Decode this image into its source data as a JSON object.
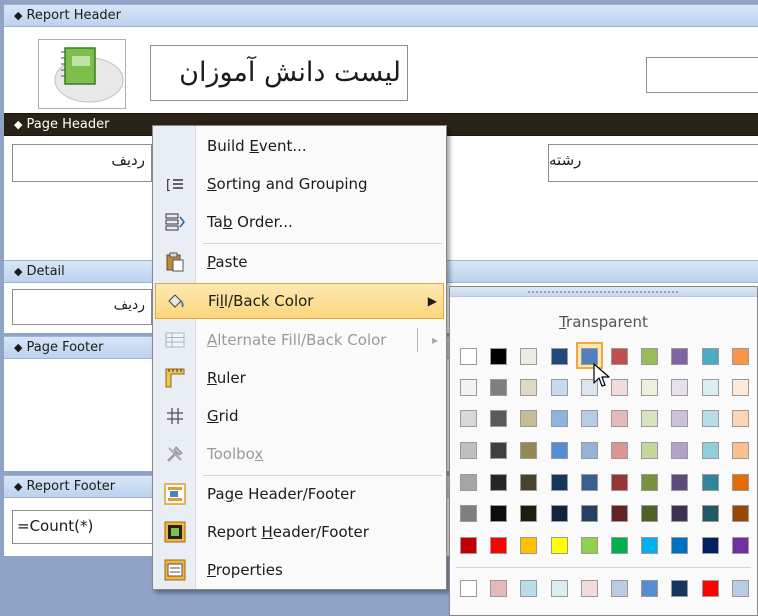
{
  "bands": {
    "report_header": "Report Header",
    "page_header": "Page Header",
    "detail": "Detail",
    "page_footer": "Page Footer",
    "report_footer": "Report Footer"
  },
  "controls": {
    "report_title": "لیست دانش آموزان",
    "header_label_row": "ردیف",
    "header_label_major": "رشته",
    "detail_row_field": "ردیف",
    "footer_count": "=Count(*)"
  },
  "menu": {
    "build_event": {
      "pre": "Build ",
      "key": "E",
      "post": "vent..."
    },
    "sorting": {
      "pre": "",
      "key": "S",
      "post": "orting and Grouping"
    },
    "tab_order": {
      "pre": "Ta",
      "key": "b",
      "post": " Order..."
    },
    "paste": {
      "pre": "",
      "key": "P",
      "post": "aste"
    },
    "fill_back": {
      "pre": "Fi",
      "key": "l",
      "post": "l/Back Color"
    },
    "alternate": {
      "pre": "",
      "key": "A",
      "post": "lternate Fill/Back Color"
    },
    "ruler": {
      "pre": "",
      "key": "R",
      "post": "uler"
    },
    "grid": {
      "pre": "",
      "key": "G",
      "post": "rid"
    },
    "toolbox": {
      "pre": "Toolbo",
      "key": "x",
      "post": ""
    },
    "page_hf": {
      "pre": "Pa",
      "key": "g",
      "post": "e Header/Footer"
    },
    "report_hf": {
      "pre": "Report ",
      "key": "H",
      "post": "eader/Footer"
    },
    "properties": {
      "pre": "",
      "key": "P",
      "post": "roperties"
    }
  },
  "palette": {
    "transparent": {
      "pre": "",
      "key": "T",
      "post": "ransparent"
    },
    "rows": [
      [
        "#ffffff",
        "#000000",
        "#eeece1",
        "#1f497d",
        "#4f81bd",
        "#c0504d",
        "#9bbb59",
        "#8064a2",
        "#4bacc6",
        "#f79646"
      ],
      [
        "#f2f2f2",
        "#7f7f7f",
        "#ddd9c3",
        "#c6d9f0",
        "#dbe5f1",
        "#f2dcdb",
        "#ebf1dd",
        "#e5e0ec",
        "#dbeef3",
        "#fdeada"
      ],
      [
        "#d8d8d8",
        "#595959",
        "#c4bd97",
        "#8db3e2",
        "#b8cce4",
        "#e5b9b7",
        "#d7e3bc",
        "#ccc1d9",
        "#b7dde8",
        "#fbd5b5"
      ],
      [
        "#bfbfbf",
        "#3f3f3f",
        "#938953",
        "#548dd4",
        "#95b3d7",
        "#d99694",
        "#c3d69b",
        "#b2a2c7",
        "#92cddc",
        "#fac08f"
      ],
      [
        "#a5a5a5",
        "#262626",
        "#494429",
        "#17365d",
        "#366092",
        "#953734",
        "#76923c",
        "#5f497a",
        "#31859b",
        "#e36c09"
      ],
      [
        "#7f7f7f",
        "#0c0c0c",
        "#1d1b10",
        "#0f243e",
        "#244061",
        "#632423",
        "#4f6128",
        "#3f3151",
        "#205867",
        "#974806"
      ],
      [
        "#c00000",
        "#ff0000",
        "#ffc000",
        "#ffff00",
        "#92d050",
        "#00b050",
        "#00b0f0",
        "#0070c0",
        "#002060",
        "#7030a0"
      ]
    ],
    "recent": [
      "#ffffff",
      "#e5b9b7",
      "#b7dde8",
      "#dbeef3",
      "#f2dcdb",
      "#b8cce4",
      "#548dd4",
      "#17365d",
      "#ff0000",
      "#b8cce4"
    ]
  }
}
